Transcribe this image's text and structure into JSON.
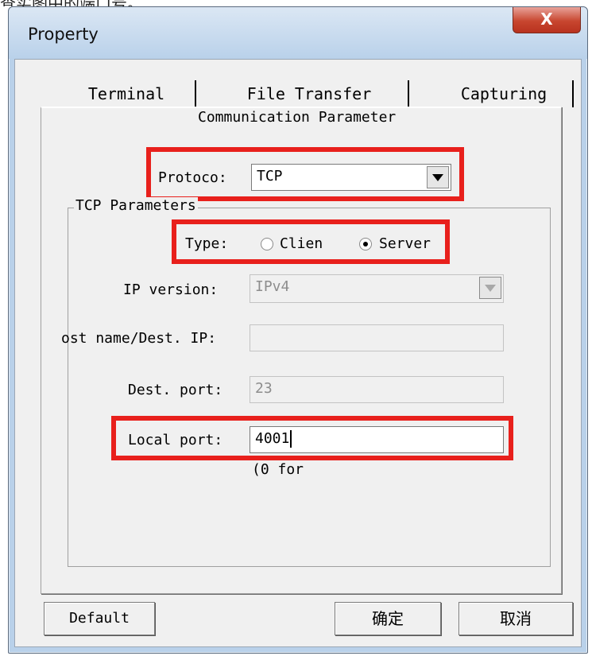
{
  "caption": "查实图中的端口号。",
  "window": {
    "title": "Property",
    "close_label": "X"
  },
  "tabs": [
    {
      "label": "Terminal"
    },
    {
      "label": "File Transfer"
    },
    {
      "label": "Capturing"
    }
  ],
  "panel": {
    "heading": "Communication Parameter",
    "protocol_label": "Protoco:",
    "protocol_value": "TCP",
    "group_title": "TCP Parameters",
    "type_label": "Type:",
    "type_options": [
      {
        "label": "Clien",
        "selected": false
      },
      {
        "label": "Server",
        "selected": true
      }
    ],
    "ip_version_label": "IP version:",
    "ip_version_value": "IPv4",
    "dest_ip_label": "ost name/Dest. IP:",
    "dest_ip_value": "",
    "dest_port_label": "Dest. port:",
    "dest_port_value": "23",
    "local_port_label": "Local port:",
    "local_port_value": "4001",
    "local_port_hint": "(0 for"
  },
  "buttons": {
    "default_label": "Default",
    "ok_label": "确定",
    "cancel_label": "取消"
  },
  "colors": {
    "highlight": "#e8201c",
    "close_button": "#c8462f",
    "window_frame": "#b9d1ea"
  }
}
